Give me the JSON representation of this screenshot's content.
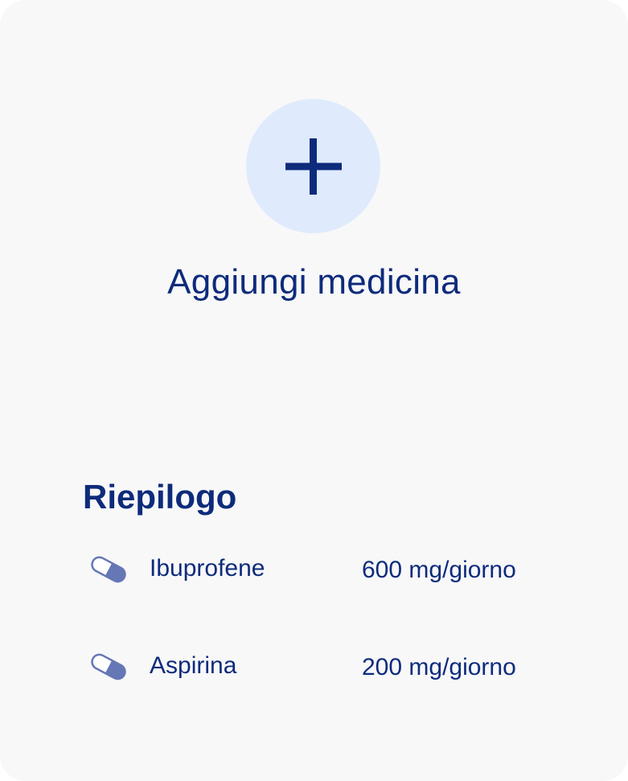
{
  "add": {
    "icon": "plus-icon",
    "label": "Aggiungi medicina"
  },
  "summary": {
    "title": "Riepilogo",
    "items": [
      {
        "icon": "pill-capsule-icon",
        "name": "Ibuprofene",
        "dose": "600 mg/giorno"
      },
      {
        "icon": "pill-capsule-icon",
        "name": "Aspirina",
        "dose": "200 mg/giorno"
      }
    ]
  },
  "colors": {
    "text": "#0e2b7b",
    "card_background": "#f8f8f9",
    "circle_background": "#dfeafd",
    "pill_accent": "#6677b6"
  }
}
